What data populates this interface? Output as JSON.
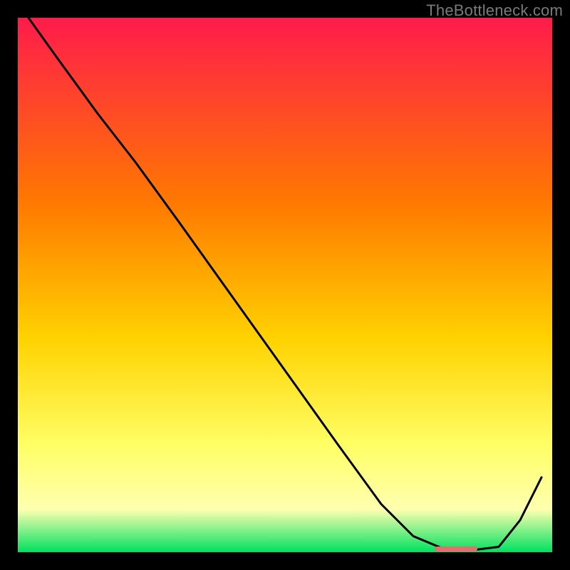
{
  "attribution": "TheBottleneck.com",
  "colors": {
    "background": "#000000",
    "gradient_top": "#ff1b4b",
    "gradient_mid1": "#ff7a00",
    "gradient_mid2": "#ffd200",
    "gradient_mid3": "#ffff66",
    "gradient_mid4": "#ffffb0",
    "gradient_bottom": "#00e060",
    "line": "#000000",
    "marker": "#e07070"
  },
  "chart_data": {
    "type": "line",
    "title": "",
    "xlabel": "",
    "ylabel": "",
    "xlim": [
      0,
      1
    ],
    "ylim": [
      0,
      1
    ],
    "x": [
      0.02,
      0.07,
      0.15,
      0.22,
      0.3,
      0.4,
      0.5,
      0.6,
      0.68,
      0.74,
      0.8,
      0.86,
      0.9,
      0.94,
      0.98
    ],
    "values": [
      1.0,
      0.93,
      0.82,
      0.73,
      0.62,
      0.48,
      0.34,
      0.2,
      0.09,
      0.03,
      0.005,
      0.005,
      0.01,
      0.06,
      0.14
    ],
    "marker": {
      "x_start": 0.78,
      "x_end": 0.86,
      "y": 0.006
    }
  }
}
